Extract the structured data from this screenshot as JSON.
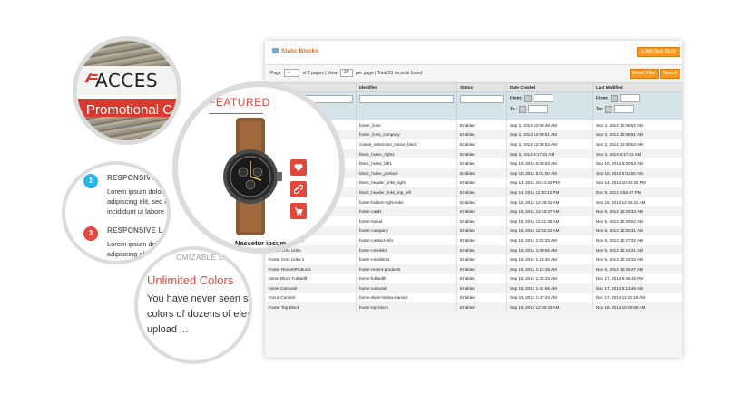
{
  "admin": {
    "title": "Static Blocks",
    "add_button": "Add New Block",
    "reset_button": "Reset Filter",
    "search_button": "Search",
    "pager": {
      "page_label": "Page",
      "page_value": "1",
      "of_pages": "of 2 pages",
      "view_label": "View",
      "per_page_value": "20",
      "per_page_label": "per page",
      "total": "Total 23 records found"
    },
    "columns": [
      "Title",
      "Identifier",
      "Status",
      "Date Created",
      "Last Modified"
    ],
    "filter": {
      "from": "From:",
      "to": "To :"
    },
    "rows": [
      [
        "Footer Links",
        "footer_links",
        "Enabled",
        "Sep 2, 2014 12:08:49 AM",
        "Sep 2, 2014 12:08:52 AM"
      ],
      [
        "Footer Links Company",
        "footer_links_company",
        "Enabled",
        "Sep 2, 2014 12:08:51 AM",
        "Sep 2, 2014 12:08:51 AM"
      ],
      [
        "Cookie restriction notice",
        "cookie_restriction_notice_block",
        "Enabled",
        "Sep 2, 2014 12:08:53 AM",
        "Sep 2, 2014 12:08:53 AM"
      ],
      [
        "Block Home Right 1",
        "block_home_right1",
        "Enabled",
        "Sep 2, 2014 8:17:31 AM",
        "Sep 2, 2014 8:17:31 AM"
      ],
      [
        "Block Home Left 1",
        "block_home_left1",
        "Enabled",
        "Sep 10, 2014 6:00:53 AM",
        "Sep 10, 2014 6:00:53 AM"
      ],
      [
        "Block Home Preface",
        "block_home_preface",
        "Enabled",
        "Sep 10, 2014 6:01:50 AM",
        "Sep 10, 2014 6:01:50 AM"
      ],
      [
        "Block Header Links Right",
        "block_header_links_right",
        "Enabled",
        "Sep 14, 2014 10:44:32 PM",
        "Sep 14, 2014 10:44:32 PM"
      ],
      [
        "Block Header Links Top Left",
        "block_header_links_top_left",
        "Enabled",
        "Sep 14, 2014 11:50:12 PM",
        "Dec 9, 2014 3:55:47 PM"
      ],
      [
        "Footer Bottom Right Links",
        "footer-bottom-right-links",
        "Enabled",
        "Sep 15, 2014 12:39:31 AM",
        "Sep 15, 2014 12:39:31 AM"
      ],
      [
        "Footer Cards",
        "footer-cards",
        "Enabled",
        "Sep 15, 2014 12:48:37 AM",
        "Nov 6, 2014 12:29:33 AM"
      ],
      [
        "Footer Social",
        "footer-social",
        "Enabled",
        "Sep 15, 2014 12:51:35 AM",
        "Nov 6, 2014 12:29:02 AM"
      ],
      [
        "Footer Company",
        "footer-company",
        "Enabled",
        "Sep 15, 2014 12:52:22 AM",
        "Nov 6, 2014 12:30:31 AM"
      ],
      [
        "Footer Contact Info",
        "footer-contact-info",
        "Enabled",
        "Sep 15, 2014 1:02:33 AM",
        "Nov 6, 2014 12:27:32 AM"
      ],
      [
        "Footer Cms Links",
        "footer-cmslinks",
        "Enabled",
        "Sep 15, 2014 1:09:55 AM",
        "Nov 6, 2014 12:24:21 AM"
      ],
      [
        "Footer Cms Links 1",
        "footer-cmslinks1",
        "Enabled",
        "Sep 15, 2014 1:10:40 AM",
        "Nov 6, 2014 12:24:33 AM"
      ],
      [
        "Footer RecentProducts",
        "footer-recent-products",
        "Enabled",
        "Sep 15, 2014 1:12:19 AM",
        "Nov 6, 2014 12:26:47 AM"
      ],
      [
        "Home Block Fullwidth",
        "home-fullwidth",
        "Enabled",
        "Sep 15, 2014 1:42:23 AM",
        "Dec 17, 2014 9:46:16 PM"
      ],
      [
        "Home Carousel",
        "home-carousel",
        "Enabled",
        "Sep 15, 2014 1:44:59 AM",
        "Dec 17, 2014 5:13:48 AM"
      ],
      [
        "Focus Content",
        "home-slider-below-banner",
        "Enabled",
        "Sep 15, 2014 1:47:43 AM",
        "Dec 17, 2014 11:18:18 AM"
      ],
      [
        "Footer Top Block",
        "footer-top-block",
        "Enabled",
        "Sep 16, 2014 12:36:43 AM",
        "Nov 18, 2014 10:09:59 AM"
      ]
    ]
  },
  "logo_circle": {
    "brand": "ACCES",
    "promo": "Promotional C"
  },
  "features": {
    "item1": {
      "number": "1",
      "title": "RESPONSIVE LA",
      "lines": [
        "Lorem ipsum dolor s",
        "adipiscing elit, sed d",
        "incididunt ut labore"
      ]
    },
    "item3": {
      "number": "3",
      "title": "RESPONSIVE LAYO",
      "lines": [
        "Lorem ipsum dolor",
        "adipiscing eli, sed"
      ]
    },
    "colors": {
      "#1": "#29b5e6",
      "#3": "#e2473c"
    }
  },
  "product_circle": {
    "heading": "FEATURED",
    "product_name": "Nascetur ipsum"
  },
  "colors_circle": {
    "subtitle": "OMIZABLE DE",
    "title": "Unlimited Colors",
    "lines": [
      "You have never seen so m",
      "colors of dozens of elem",
      "upload ..."
    ]
  },
  "theme": {
    "accent": "#e2473c",
    "orange": "#f39a25"
  }
}
